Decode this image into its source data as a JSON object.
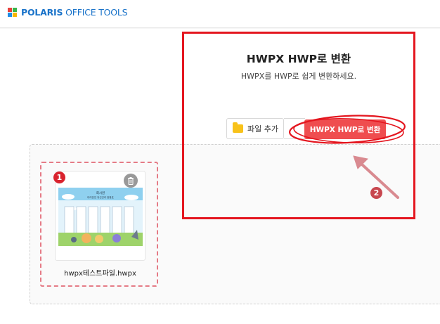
{
  "header": {
    "brand_bold": "POLARIS",
    "brand_light": " OFFICE TOOLS"
  },
  "main": {
    "title": "HWPX HWP로 변환",
    "subtitle": "HWPX를 HWP로 쉽게 변환하세요."
  },
  "toolbar": {
    "add_file_label": "파일 추가",
    "convert_label": "HWPX HWP로 변환"
  },
  "file": {
    "name": "hwpx테스트파일.hwpx",
    "thumb_title": "회시원",
    "thumb_subtitle": "대리운전 유선관리 현황표"
  },
  "annotations": {
    "marker1": "1",
    "marker2": "2"
  },
  "colors": {
    "accent": "#ef4d4f",
    "highlight": "#e4161f",
    "brand": "#1a73c9"
  }
}
